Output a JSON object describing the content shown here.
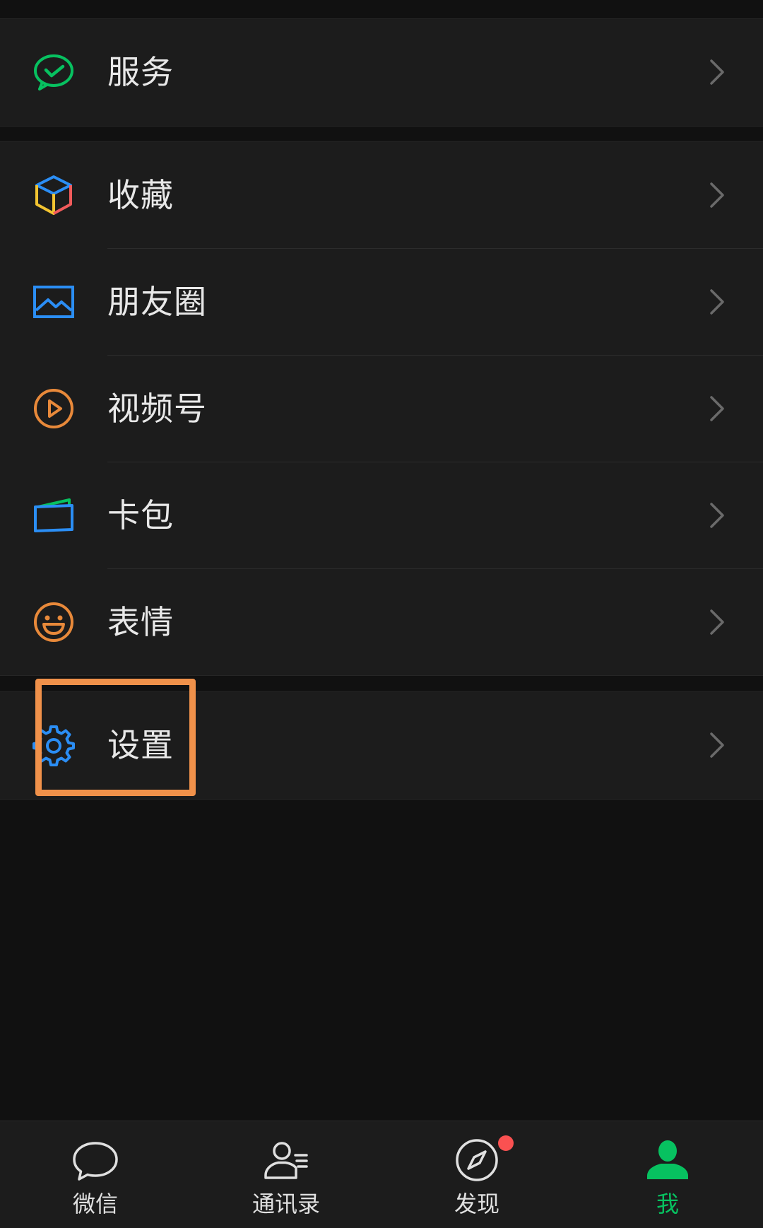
{
  "menu": {
    "service": {
      "label": "服务",
      "icon": "wechat-pay-icon",
      "color": "#07c160"
    },
    "items": [
      {
        "label": "收藏",
        "icon": "favorites-cube-icon"
      },
      {
        "label": "朋友圈",
        "icon": "moments-image-icon",
        "color": "#2b8ef5"
      },
      {
        "label": "视频号",
        "icon": "channels-play-icon",
        "color": "#e8893a"
      },
      {
        "label": "卡包",
        "icon": "card-wallet-icon",
        "color": "#2b8ef5"
      },
      {
        "label": "表情",
        "icon": "sticker-smile-icon",
        "color": "#e8893a"
      }
    ],
    "settings": {
      "label": "设置",
      "icon": "gear-icon",
      "color": "#2b8ef5"
    }
  },
  "highlight_color": "#f0914a",
  "tabbar": {
    "tabs": [
      {
        "label": "微信",
        "icon": "chat-bubble-icon"
      },
      {
        "label": "通讯录",
        "icon": "contacts-icon"
      },
      {
        "label": "发现",
        "icon": "discover-compass-icon",
        "badge": true
      },
      {
        "label": "我",
        "icon": "me-person-icon",
        "active": true,
        "color": "#07c160"
      }
    ]
  }
}
